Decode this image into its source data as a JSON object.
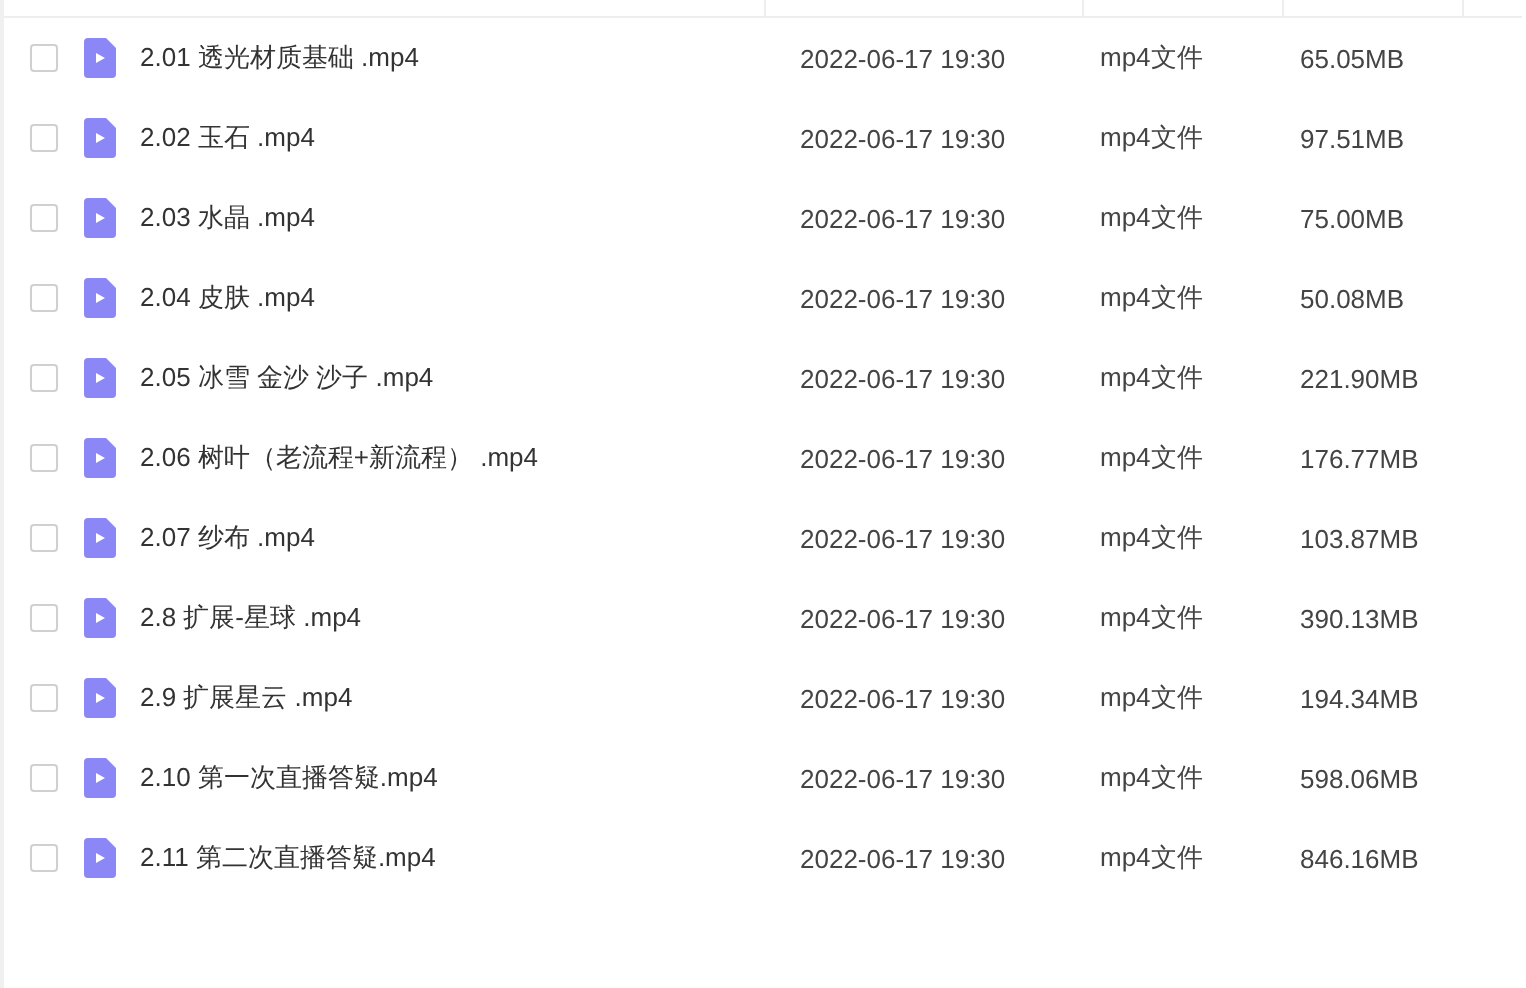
{
  "files": [
    {
      "name": "2.01 透光材质基础 .mp4",
      "modified": "2022-06-17 19:30",
      "type": "mp4文件",
      "size": "65.05MB",
      "checked": false
    },
    {
      "name": "2.02 玉石 .mp4",
      "modified": "2022-06-17 19:30",
      "type": "mp4文件",
      "size": "97.51MB",
      "checked": false
    },
    {
      "name": "2.03 水晶 .mp4",
      "modified": "2022-06-17 19:30",
      "type": "mp4文件",
      "size": "75.00MB",
      "checked": false
    },
    {
      "name": "2.04 皮肤 .mp4",
      "modified": "2022-06-17 19:30",
      "type": "mp4文件",
      "size": "50.08MB",
      "checked": false
    },
    {
      "name": "2.05 冰雪 金沙 沙子 .mp4",
      "modified": "2022-06-17 19:30",
      "type": "mp4文件",
      "size": "221.90MB",
      "checked": false
    },
    {
      "name": "2.06 树叶（老流程+新流程） .mp4",
      "modified": "2022-06-17 19:30",
      "type": "mp4文件",
      "size": "176.77MB",
      "checked": false
    },
    {
      "name": "2.07 纱布 .mp4",
      "modified": "2022-06-17 19:30",
      "type": "mp4文件",
      "size": "103.87MB",
      "checked": false
    },
    {
      "name": "2.8 扩展-星球 .mp4",
      "modified": "2022-06-17 19:30",
      "type": "mp4文件",
      "size": "390.13MB",
      "checked": false
    },
    {
      "name": "2.9 扩展星云 .mp4",
      "modified": "2022-06-17 19:30",
      "type": "mp4文件",
      "size": "194.34MB",
      "checked": false
    },
    {
      "name": "2.10 第一次直播答疑.mp4",
      "modified": "2022-06-17 19:30",
      "type": "mp4文件",
      "size": "598.06MB",
      "checked": false
    },
    {
      "name": "2.11 第二次直播答疑.mp4",
      "modified": "2022-06-17 19:30",
      "type": "mp4文件",
      "size": "846.16MB",
      "checked": false
    }
  ]
}
